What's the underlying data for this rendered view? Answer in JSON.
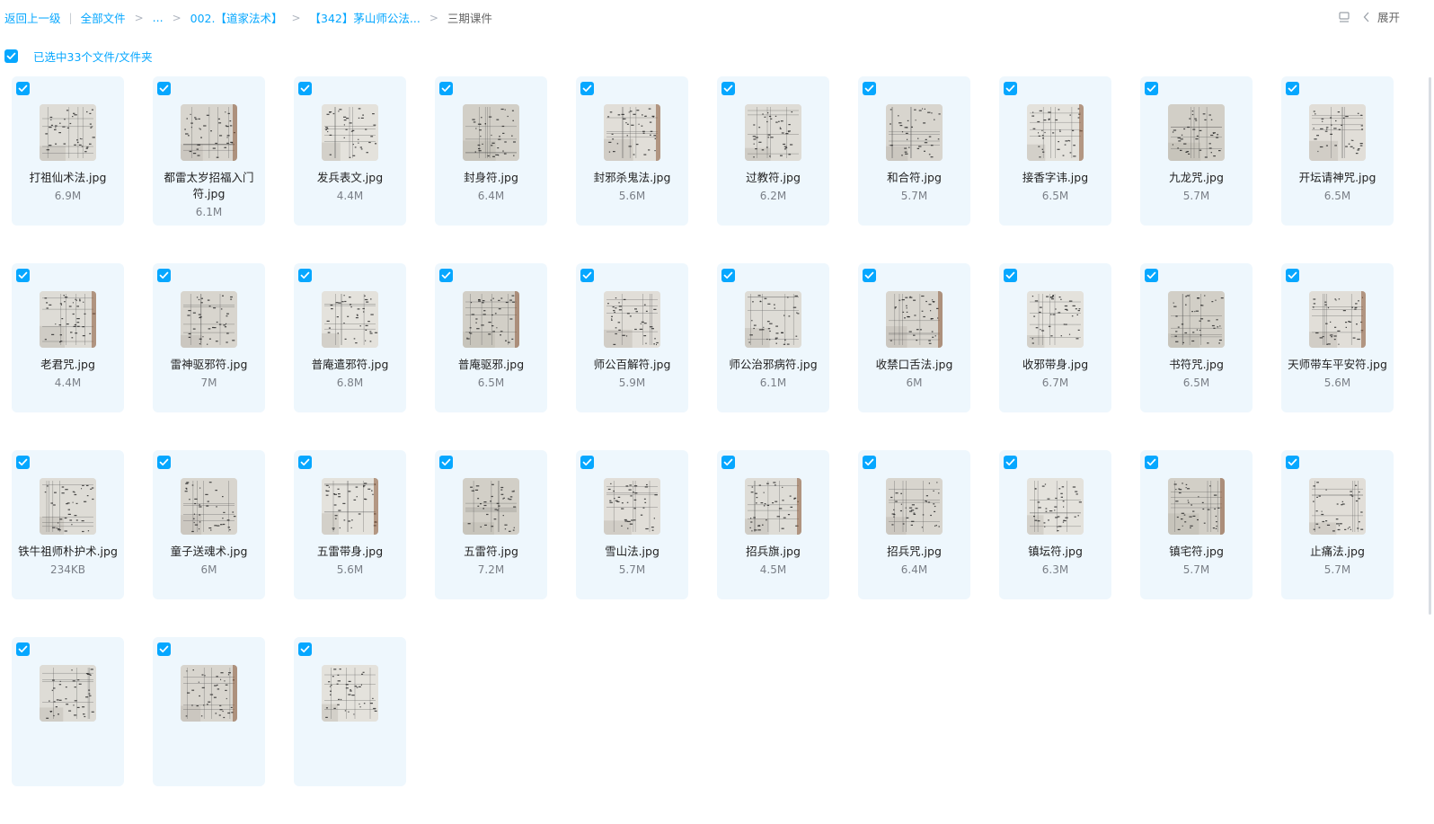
{
  "breadcrumb": {
    "back": "返回上一级",
    "root": "全部文件",
    "ellipsis": "...",
    "level1": "002.【道家法术】",
    "level2": "【342】茅山师公法...",
    "current": "三期课件",
    "sep": ">",
    "bar": "|"
  },
  "toolbar": {
    "expand_label": "展开"
  },
  "selection": {
    "text": "已选中33个文件/文件夹"
  },
  "colors": {
    "accent": "#06a7ff",
    "card_bg": "#eef7fd"
  },
  "files": [
    {
      "name": "打祖仙术法.jpg",
      "size": "6.9M"
    },
    {
      "name": "都雷太岁招福入门符.jpg",
      "size": "6.1M"
    },
    {
      "name": "发兵表文.jpg",
      "size": "4.4M"
    },
    {
      "name": "封身符.jpg",
      "size": "6.4M"
    },
    {
      "name": "封邪杀鬼法.jpg",
      "size": "5.6M"
    },
    {
      "name": "过教符.jpg",
      "size": "6.2M"
    },
    {
      "name": "和合符.jpg",
      "size": "5.7M"
    },
    {
      "name": "接香字讳.jpg",
      "size": "6.5M"
    },
    {
      "name": "九龙咒.jpg",
      "size": "5.7M"
    },
    {
      "name": "开坛请神咒.jpg",
      "size": "6.5M"
    },
    {
      "name": "老君咒.jpg",
      "size": "4.4M"
    },
    {
      "name": "雷神驱邪符.jpg",
      "size": "7M"
    },
    {
      "name": "普庵遣邪符.jpg",
      "size": "6.8M"
    },
    {
      "name": "普庵驱邪.jpg",
      "size": "6.5M"
    },
    {
      "name": "师公百解符.jpg",
      "size": "5.9M"
    },
    {
      "name": "师公治邪病符.jpg",
      "size": "6.1M"
    },
    {
      "name": "收禁口舌法.jpg",
      "size": "6M"
    },
    {
      "name": "收邪带身.jpg",
      "size": "6.7M"
    },
    {
      "name": "书符咒.jpg",
      "size": "6.5M"
    },
    {
      "name": "天师带车平安符.jpg",
      "size": "5.6M"
    },
    {
      "name": "铁牛祖师朴护术.jpg",
      "size": "234KB"
    },
    {
      "name": "童子送魂术.jpg",
      "size": "6M"
    },
    {
      "name": "五雷带身.jpg",
      "size": "5.6M"
    },
    {
      "name": "五雷符.jpg",
      "size": "7.2M"
    },
    {
      "name": "雪山法.jpg",
      "size": "5.7M"
    },
    {
      "name": "招兵旗.jpg",
      "size": "4.5M"
    },
    {
      "name": "招兵咒.jpg",
      "size": "6.4M"
    },
    {
      "name": "镇坛符.jpg",
      "size": "6.3M"
    },
    {
      "name": "镇宅符.jpg",
      "size": "5.7M"
    },
    {
      "name": "止痛法.jpg",
      "size": "5.7M"
    },
    {
      "name": "",
      "size": ""
    },
    {
      "name": "",
      "size": ""
    },
    {
      "name": "",
      "size": ""
    }
  ]
}
